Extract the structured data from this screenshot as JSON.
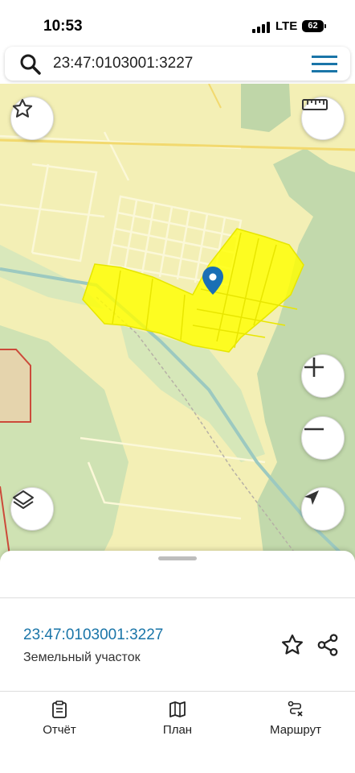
{
  "status_bar": {
    "time": "10:53",
    "network": "LTE",
    "battery": "62"
  },
  "search": {
    "query": "23:47:0103001:3227"
  },
  "map_controls": {
    "favorite": "star-icon",
    "ruler": "ruler-icon",
    "layers": "layers-icon",
    "zoom_in": "plus-icon",
    "zoom_out": "minus-icon",
    "locate": "navigation-arrow-icon"
  },
  "map": {
    "marker_color": "#1a6fb5",
    "parcel_color": "#ffff00",
    "forest_color": "#bfd6a8"
  },
  "sheet": {
    "parcel_number": "23:47:0103001:3227",
    "parcel_type": "Земельный участок"
  },
  "actions": [
    {
      "label": "Отчёт",
      "icon": "clipboard-icon"
    },
    {
      "label": "План",
      "icon": "map-icon"
    },
    {
      "label": "Маршрут",
      "icon": "route-icon"
    }
  ]
}
